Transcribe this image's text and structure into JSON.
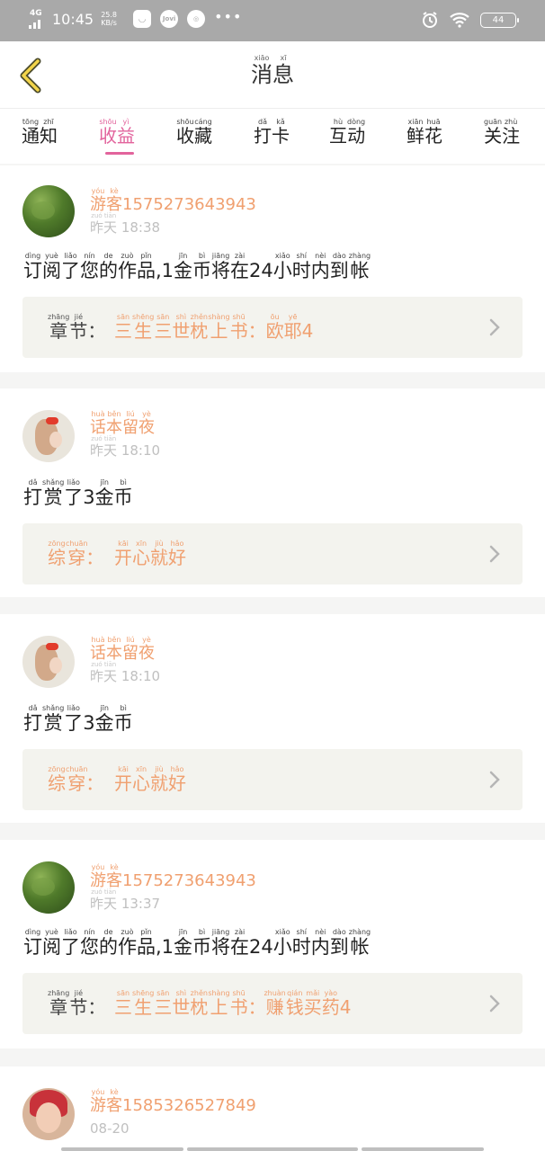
{
  "statusbar": {
    "network": "4G",
    "time": "10:45",
    "speed_value": "25.8",
    "speed_unit": "KB/s",
    "app1": "◡",
    "app2": "Jovi",
    "dots": "•••",
    "battery": "44"
  },
  "header": {
    "title": [
      {
        "char": "消",
        "py": "xiāo"
      },
      {
        "char": "息",
        "py": "xī"
      }
    ]
  },
  "tabs": [
    {
      "name": "tongzhi",
      "chars": [
        {
          "char": "通",
          "py": "tōng"
        },
        {
          "char": "知",
          "py": "zhī"
        }
      ],
      "active": false
    },
    {
      "name": "shouyi",
      "chars": [
        {
          "char": "收",
          "py": "shōu"
        },
        {
          "char": "益",
          "py": "yì"
        }
      ],
      "active": true
    },
    {
      "name": "shoucang",
      "chars": [
        {
          "char": "收",
          "py": "shōu"
        },
        {
          "char": "藏",
          "py": "cáng"
        }
      ],
      "active": false
    },
    {
      "name": "daka",
      "chars": [
        {
          "char": "打",
          "py": "dǎ"
        },
        {
          "char": "卡",
          "py": "kǎ"
        }
      ],
      "active": false
    },
    {
      "name": "hudong",
      "chars": [
        {
          "char": "互",
          "py": "hù"
        },
        {
          "char": "动",
          "py": "dòng"
        }
      ],
      "active": false
    },
    {
      "name": "xianhua",
      "chars": [
        {
          "char": "鲜",
          "py": "xiān"
        },
        {
          "char": "花",
          "py": "huā"
        }
      ],
      "active": false
    },
    {
      "name": "guanzhu",
      "chars": [
        {
          "char": "关",
          "py": "guān"
        },
        {
          "char": "注",
          "py": "zhù"
        }
      ],
      "active": false
    }
  ],
  "cards": [
    {
      "avatar": "moss",
      "user": "游客15752736439​43",
      "user_py": [
        "yóu",
        "kè"
      ],
      "user_id": "1575273643943",
      "date_chars": [
        {
          "char": "昨",
          "py": "zuó"
        },
        {
          "char": "天",
          "py": "tiān"
        }
      ],
      "time": "18:38",
      "message": [
        {
          "char": "订",
          "py": "dìng"
        },
        {
          "char": "阅",
          "py": "yuè"
        },
        {
          "char": "了",
          "py": "liǎo"
        },
        {
          "char": "您",
          "py": "nín"
        },
        {
          "char": "的",
          "py": "de"
        },
        {
          "char": "作",
          "py": "zuò"
        },
        {
          "char": "品",
          "py": "pǐn"
        },
        {
          "char": ",1",
          "py": ""
        },
        {
          "char": "金",
          "py": "jīn"
        },
        {
          "char": "币",
          "py": "bì"
        },
        {
          "char": "将",
          "py": "jiāng"
        },
        {
          "char": "在",
          "py": "zài"
        },
        {
          "char": "24",
          "py": ""
        },
        {
          "char": "小",
          "py": "xiǎo"
        },
        {
          "char": "时",
          "py": "shí"
        },
        {
          "char": "内",
          "py": "nèi"
        },
        {
          "char": "到",
          "py": "dào"
        },
        {
          "char": "帐",
          "py": "zhàng"
        }
      ],
      "chapter_label": [
        {
          "char": "章",
          "py": "zhāng"
        },
        {
          "char": "节",
          "py": "jié"
        },
        {
          "char": "：",
          "py": ""
        }
      ],
      "chapter_label_orange": false,
      "chapter_value": [
        {
          "char": "三",
          "py": "sān"
        },
        {
          "char": "生",
          "py": "shēng"
        },
        {
          "char": "三",
          "py": "sān"
        },
        {
          "char": "世",
          "py": "shì"
        },
        {
          "char": "枕",
          "py": "zhěn"
        },
        {
          "char": "上",
          "py": "shàng"
        },
        {
          "char": "书",
          "py": "shū"
        },
        {
          "char": "：",
          "py": ""
        },
        {
          "char": "欧",
          "py": "ōu"
        },
        {
          "char": "耶",
          "py": "yē"
        },
        {
          "char": "4",
          "py": ""
        }
      ]
    },
    {
      "avatar": "girl",
      "user": "话本留夜",
      "user_chars": [
        {
          "char": "话",
          "py": "huà"
        },
        {
          "char": "本",
          "py": "běn"
        },
        {
          "char": "留",
          "py": "liú"
        },
        {
          "char": "夜",
          "py": "yè"
        }
      ],
      "date_chars": [
        {
          "char": "昨",
          "py": "zuó"
        },
        {
          "char": "天",
          "py": "tiān"
        }
      ],
      "time": "18:10",
      "message": [
        {
          "char": "打",
          "py": "dǎ"
        },
        {
          "char": "赏",
          "py": "shǎng"
        },
        {
          "char": "了",
          "py": "liǎo"
        },
        {
          "char": "3",
          "py": ""
        },
        {
          "char": "金",
          "py": "jīn"
        },
        {
          "char": "币",
          "py": "bì"
        }
      ],
      "chapter_label": [
        {
          "char": "综",
          "py": "zōng"
        },
        {
          "char": "穿",
          "py": "chuān"
        },
        {
          "char": "：",
          "py": ""
        }
      ],
      "chapter_label_orange": true,
      "chapter_value": [
        {
          "char": "开",
          "py": "kāi"
        },
        {
          "char": "心",
          "py": "xīn"
        },
        {
          "char": "就",
          "py": "jiù"
        },
        {
          "char": "好",
          "py": "hǎo"
        }
      ]
    },
    {
      "avatar": "girl",
      "user": "话本留夜",
      "user_chars": [
        {
          "char": "话",
          "py": "huà"
        },
        {
          "char": "本",
          "py": "běn"
        },
        {
          "char": "留",
          "py": "liú"
        },
        {
          "char": "夜",
          "py": "yè"
        }
      ],
      "date_chars": [
        {
          "char": "昨",
          "py": "zuó"
        },
        {
          "char": "天",
          "py": "tiān"
        }
      ],
      "time": "18:10",
      "message": [
        {
          "char": "打",
          "py": "dǎ"
        },
        {
          "char": "赏",
          "py": "shǎng"
        },
        {
          "char": "了",
          "py": "liǎo"
        },
        {
          "char": "3",
          "py": ""
        },
        {
          "char": "金",
          "py": "jīn"
        },
        {
          "char": "币",
          "py": "bì"
        }
      ],
      "chapter_label": [
        {
          "char": "综",
          "py": "zōng"
        },
        {
          "char": "穿",
          "py": "chuān"
        },
        {
          "char": "：",
          "py": ""
        }
      ],
      "chapter_label_orange": true,
      "chapter_value": [
        {
          "char": "开",
          "py": "kāi"
        },
        {
          "char": "心",
          "py": "xīn"
        },
        {
          "char": "就",
          "py": "jiù"
        },
        {
          "char": "好",
          "py": "hǎo"
        }
      ]
    },
    {
      "avatar": "moss",
      "user_id": "1575273643943",
      "date_chars": [
        {
          "char": "昨",
          "py": "zuó"
        },
        {
          "char": "天",
          "py": "tiān"
        }
      ],
      "time": "13:37",
      "message": [
        {
          "char": "订",
          "py": "dìng"
        },
        {
          "char": "阅",
          "py": "yuè"
        },
        {
          "char": "了",
          "py": "liǎo"
        },
        {
          "char": "您",
          "py": "nín"
        },
        {
          "char": "的",
          "py": "de"
        },
        {
          "char": "作",
          "py": "zuò"
        },
        {
          "char": "品",
          "py": "pǐn"
        },
        {
          "char": ",1",
          "py": ""
        },
        {
          "char": "金",
          "py": "jīn"
        },
        {
          "char": "币",
          "py": "bì"
        },
        {
          "char": "将",
          "py": "jiāng"
        },
        {
          "char": "在",
          "py": "zài"
        },
        {
          "char": "24",
          "py": ""
        },
        {
          "char": "小",
          "py": "xiǎo"
        },
        {
          "char": "时",
          "py": "shí"
        },
        {
          "char": "内",
          "py": "nèi"
        },
        {
          "char": "到",
          "py": "dào"
        },
        {
          "char": "帐",
          "py": "zhàng"
        }
      ],
      "chapter_label": [
        {
          "char": "章",
          "py": "zhāng"
        },
        {
          "char": "节",
          "py": "jié"
        },
        {
          "char": "：",
          "py": ""
        }
      ],
      "chapter_label_orange": false,
      "chapter_value": [
        {
          "char": "三",
          "py": "sān"
        },
        {
          "char": "生",
          "py": "shēng"
        },
        {
          "char": "三",
          "py": "sān"
        },
        {
          "char": "世",
          "py": "shì"
        },
        {
          "char": "枕",
          "py": "zhěn"
        },
        {
          "char": "上",
          "py": "shàng"
        },
        {
          "char": "书",
          "py": "shū"
        },
        {
          "char": "：",
          "py": ""
        },
        {
          "char": "赚",
          "py": "zhuàn"
        },
        {
          "char": "钱",
          "py": "qián"
        },
        {
          "char": "买",
          "py": "mǎi"
        },
        {
          "char": "药",
          "py": "yào"
        },
        {
          "char": "4",
          "py": ""
        }
      ]
    },
    {
      "avatar": "woman",
      "user_id": "15853265278​49",
      "date": "08-20"
    }
  ],
  "labels": {
    "youke": [
      {
        "char": "游",
        "py": "yóu"
      },
      {
        "char": "客",
        "py": "kè"
      }
    ]
  }
}
